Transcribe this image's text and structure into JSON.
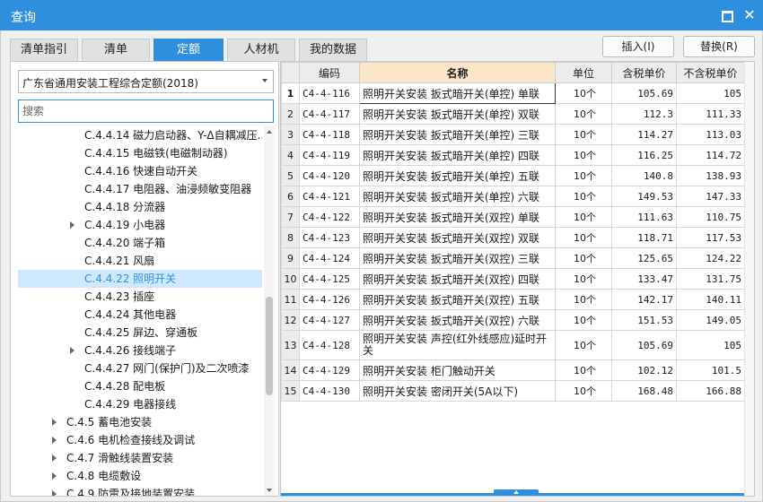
{
  "window": {
    "title": "查询"
  },
  "tabs": [
    "清单指引",
    "清单",
    "定额",
    "人材机",
    "我的数据"
  ],
  "buttons": {
    "insert": "插入(I)",
    "replace": "替换(R)"
  },
  "left": {
    "library": "广东省通用安装工程综合定额(2018)",
    "search_placeholder": "搜索",
    "tree": [
      {
        "label": "C.4.4.14 磁力启动器、Y-Δ自耦减压...",
        "level": 3,
        "arrow": false
      },
      {
        "label": "C.4.4.15 电磁铁(电磁制动器)",
        "level": 3,
        "arrow": false
      },
      {
        "label": "C.4.4.16 快速自动开关",
        "level": 3,
        "arrow": false
      },
      {
        "label": "C.4.4.17 电阻器、油浸频敏变阻器",
        "level": 3,
        "arrow": false
      },
      {
        "label": "C.4.4.18 分流器",
        "level": 3,
        "arrow": false
      },
      {
        "label": "C.4.4.19 小电器",
        "level": 3,
        "arrow": true
      },
      {
        "label": "C.4.4.20 端子箱",
        "level": 3,
        "arrow": false
      },
      {
        "label": "C.4.4.21 风扇",
        "level": 3,
        "arrow": false
      },
      {
        "label": "C.4.4.22 照明开关",
        "level": 3,
        "arrow": false,
        "selected": true
      },
      {
        "label": "C.4.4.23 插座",
        "level": 3,
        "arrow": false
      },
      {
        "label": "C.4.4.24 其他电器",
        "level": 3,
        "arrow": false
      },
      {
        "label": "C.4.4.25 屏边、穿通板",
        "level": 3,
        "arrow": false
      },
      {
        "label": "C.4.4.26 接线端子",
        "level": 3,
        "arrow": true
      },
      {
        "label": "C.4.4.27 网门(保护门)及二次喷漆",
        "level": 3,
        "arrow": false
      },
      {
        "label": "C.4.4.28 配电板",
        "level": 3,
        "arrow": false
      },
      {
        "label": "C.4.4.29 电器接线",
        "level": 3,
        "arrow": false
      },
      {
        "label": "C.4.5 蓄电池安装",
        "level": 2,
        "arrow": true
      },
      {
        "label": "C.4.6 电机检查接线及调试",
        "level": 2,
        "arrow": true
      },
      {
        "label": "C.4.7 滑触线装置安装",
        "level": 2,
        "arrow": true
      },
      {
        "label": "C.4.8 电缆敷设",
        "level": 2,
        "arrow": true
      },
      {
        "label": "C.4.9 防雷及接地装置安装",
        "level": 2,
        "arrow": true
      }
    ]
  },
  "grid": {
    "columns": [
      "编码",
      "名称",
      "单位",
      "含税单价",
      "不含税单价"
    ],
    "rows": [
      {
        "no": "1",
        "code": "C4-4-116",
        "name": "照明开关安装 扳式暗开关(单控) 单联",
        "unit": "10个",
        "tax": "105.69",
        "notax": "105"
      },
      {
        "no": "2",
        "code": "C4-4-117",
        "name": "照明开关安装 扳式暗开关(单控) 双联",
        "unit": "10个",
        "tax": "112.3",
        "notax": "111.33"
      },
      {
        "no": "3",
        "code": "C4-4-118",
        "name": "照明开关安装 扳式暗开关(单控) 三联",
        "unit": "10个",
        "tax": "114.27",
        "notax": "113.03"
      },
      {
        "no": "4",
        "code": "C4-4-119",
        "name": "照明开关安装 扳式暗开关(单控) 四联",
        "unit": "10个",
        "tax": "116.25",
        "notax": "114.72"
      },
      {
        "no": "5",
        "code": "C4-4-120",
        "name": "照明开关安装 扳式暗开关(单控) 五联",
        "unit": "10个",
        "tax": "140.8",
        "notax": "138.93"
      },
      {
        "no": "6",
        "code": "C4-4-121",
        "name": "照明开关安装 扳式暗开关(单控) 六联",
        "unit": "10个",
        "tax": "149.53",
        "notax": "147.33"
      },
      {
        "no": "7",
        "code": "C4-4-122",
        "name": "照明开关安装 扳式暗开关(双控) 单联",
        "unit": "10个",
        "tax": "111.63",
        "notax": "110.75"
      },
      {
        "no": "8",
        "code": "C4-4-123",
        "name": "照明开关安装 扳式暗开关(双控) 双联",
        "unit": "10个",
        "tax": "118.71",
        "notax": "117.53"
      },
      {
        "no": "9",
        "code": "C4-4-124",
        "name": "照明开关安装 扳式暗开关(双控) 三联",
        "unit": "10个",
        "tax": "125.65",
        "notax": "124.22"
      },
      {
        "no": "10",
        "code": "C4-4-125",
        "name": "照明开关安装 扳式暗开关(双控) 四联",
        "unit": "10个",
        "tax": "133.47",
        "notax": "131.75"
      },
      {
        "no": "11",
        "code": "C4-4-126",
        "name": "照明开关安装 扳式暗开关(双控) 五联",
        "unit": "10个",
        "tax": "142.17",
        "notax": "140.11"
      },
      {
        "no": "12",
        "code": "C4-4-127",
        "name": "照明开关安装 扳式暗开关(双控) 六联",
        "unit": "10个",
        "tax": "151.53",
        "notax": "149.05"
      },
      {
        "no": "13",
        "code": "C4-4-128",
        "name": "照明开关安装 声控(红外线感应)延时开关",
        "unit": "10个",
        "tax": "105.69",
        "notax": "105"
      },
      {
        "no": "14",
        "code": "C4-4-129",
        "name": "照明开关安装 柜门触动开关",
        "unit": "10个",
        "tax": "102.12",
        "notax": "101.5"
      },
      {
        "no": "15",
        "code": "C4-4-130",
        "name": "照明开关安装 密闭开关(5A以下)",
        "unit": "10个",
        "tax": "168.48",
        "notax": "166.88"
      }
    ]
  },
  "colors": {
    "accent": "#2f8fdf",
    "header_highlight": "#fce6c8",
    "selection": "#cde8ff"
  }
}
